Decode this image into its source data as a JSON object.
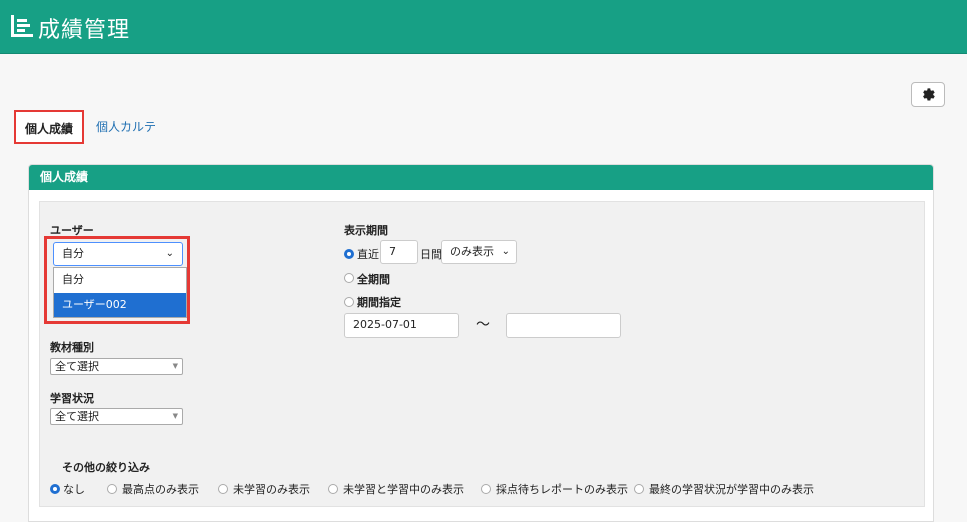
{
  "header": {
    "title": "成績管理"
  },
  "tabs": [
    {
      "label": "個人成績",
      "active": true
    },
    {
      "label": "個人カルテ",
      "active": false
    }
  ],
  "panel": {
    "title": "個人成績"
  },
  "user": {
    "label": "ユーザー",
    "selected": "自分",
    "options": [
      "自分",
      "ユーザー002"
    ],
    "highlighted": "ユーザー002"
  },
  "period": {
    "label": "表示期間",
    "recent_label": "直近",
    "recent_days": "7",
    "days_unit": "日間",
    "mode_select": "のみ表示",
    "all_label": "全期間",
    "range_label": "期間指定",
    "from_date": "2025-07-01",
    "to_date": "",
    "tilde": "～"
  },
  "material_type": {
    "label": "教材種別",
    "value": "全て選択"
  },
  "study_status": {
    "label": "学習状況",
    "value": "全て選択"
  },
  "other_filter": {
    "label": "その他の絞り込み",
    "options": [
      "なし",
      "最高点のみ表示",
      "未学習のみ表示",
      "未学習と学習中のみ表示",
      "採点待ちレポートのみ表示",
      "最終の学習状況が学習中のみ表示"
    ],
    "selected_index": 0
  },
  "colors": {
    "brand": "#17a085",
    "highlight": "#1f6fd1",
    "outline": "#e53935"
  }
}
